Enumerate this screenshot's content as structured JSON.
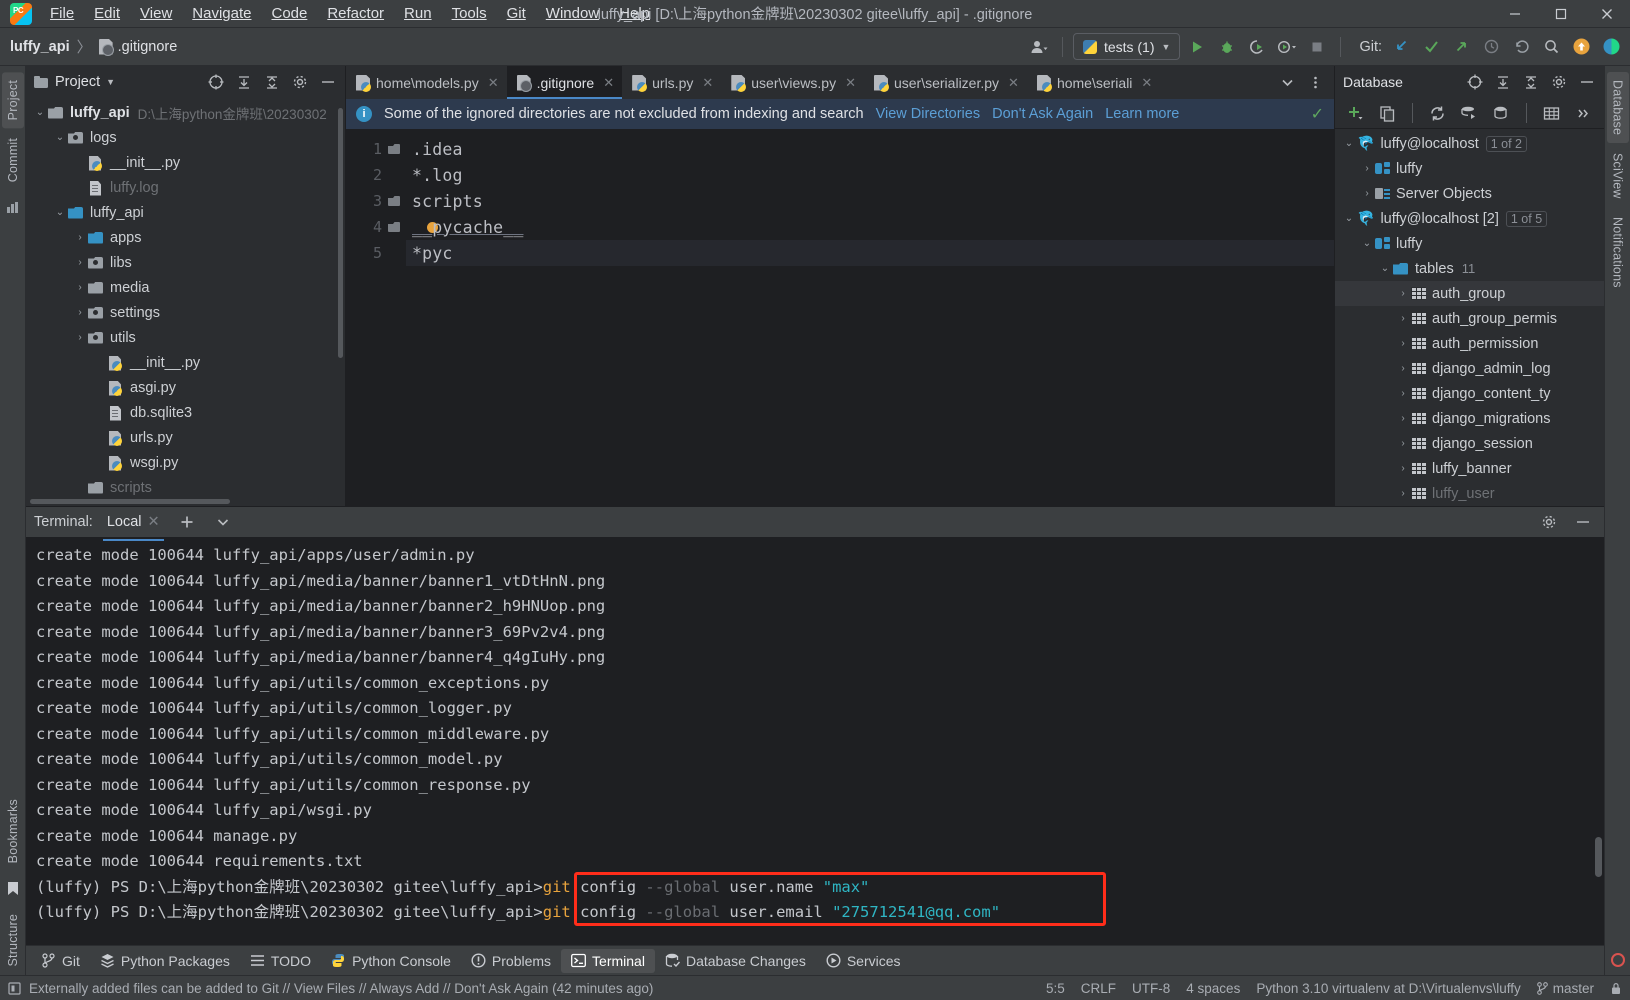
{
  "window": {
    "title": "luffy_api [D:\\上海python金牌班\\20230302 gitee\\luffy_api] - .gitignore",
    "minimize": "—",
    "maximize": "▢",
    "close": "✕"
  },
  "menu": {
    "items": [
      "File",
      "Edit",
      "View",
      "Navigate",
      "Code",
      "Refactor",
      "Run",
      "Tools",
      "Git",
      "Window",
      "Help"
    ]
  },
  "navbar": {
    "breadcrumb_project": "luffy_api",
    "breadcrumb_sep": "〉",
    "breadcrumb_file": ".gitignore",
    "run_config": "tests (1)",
    "git_label": "Git:"
  },
  "project_panel": {
    "title": "Project",
    "tree": [
      {
        "indent": 0,
        "arrow": "⌄",
        "icon": "folder",
        "label": "luffy_api",
        "bold": true,
        "note": "D:\\上海python金牌班\\20230302"
      },
      {
        "indent": 1,
        "arrow": "⌄",
        "icon": "folder-module",
        "label": "logs",
        "bold": false,
        "note": ""
      },
      {
        "indent": 2,
        "arrow": "",
        "icon": "python-file",
        "label": "__init__.py",
        "bold": false,
        "note": ""
      },
      {
        "indent": 2,
        "arrow": "",
        "icon": "text-file",
        "label": "luffy.log",
        "bold": false,
        "note": "",
        "dim": true
      },
      {
        "indent": 1,
        "arrow": "⌄",
        "icon": "folder-blue",
        "label": "luffy_api",
        "bold": false,
        "note": ""
      },
      {
        "indent": 2,
        "arrow": "›",
        "icon": "folder-blue",
        "label": "apps",
        "bold": false,
        "note": ""
      },
      {
        "indent": 2,
        "arrow": "›",
        "icon": "folder-module",
        "label": "libs",
        "bold": false,
        "note": ""
      },
      {
        "indent": 2,
        "arrow": "›",
        "icon": "folder",
        "label": "media",
        "bold": false,
        "note": ""
      },
      {
        "indent": 2,
        "arrow": "›",
        "icon": "folder-module",
        "label": "settings",
        "bold": false,
        "note": ""
      },
      {
        "indent": 2,
        "arrow": "›",
        "icon": "folder-module",
        "label": "utils",
        "bold": false,
        "note": ""
      },
      {
        "indent": 3,
        "arrow": "",
        "icon": "python-file",
        "label": "__init__.py",
        "bold": false,
        "note": ""
      },
      {
        "indent": 3,
        "arrow": "",
        "icon": "python-file",
        "label": "asgi.py",
        "bold": false,
        "note": ""
      },
      {
        "indent": 3,
        "arrow": "",
        "icon": "text-file",
        "label": "db.sqlite3",
        "bold": false,
        "note": ""
      },
      {
        "indent": 3,
        "arrow": "",
        "icon": "python-file",
        "label": "urls.py",
        "bold": false,
        "note": ""
      },
      {
        "indent": 3,
        "arrow": "",
        "icon": "python-file",
        "label": "wsgi.py",
        "bold": false,
        "note": ""
      },
      {
        "indent": 2,
        "arrow": "",
        "icon": "folder",
        "label": "scripts",
        "bold": false,
        "note": "",
        "dim": true
      }
    ]
  },
  "editor": {
    "tabs": [
      {
        "label": "home\\models.py",
        "active": false,
        "icon": "python-file"
      },
      {
        "label": ".gitignore",
        "active": true,
        "icon": "gitignore-file"
      },
      {
        "label": "urls.py",
        "active": false,
        "icon": "python-file"
      },
      {
        "label": "user\\views.py",
        "active": false,
        "icon": "python-file"
      },
      {
        "label": "user\\serializer.py",
        "active": false,
        "icon": "python-file"
      },
      {
        "label": "home\\seriali",
        "active": false,
        "icon": "python-file"
      }
    ],
    "notification": {
      "message": "Some of the ignored directories are not excluded from indexing and search",
      "action_view": "View Directories",
      "action_dismiss": "Don't Ask Again",
      "action_learn": "Learn more"
    },
    "lines": [
      {
        "n": "1",
        "fold": true,
        "text": ".idea"
      },
      {
        "n": "2",
        "fold": false,
        "text": "*.log"
      },
      {
        "n": "3",
        "fold": true,
        "text": "scripts"
      },
      {
        "n": "4",
        "fold": true,
        "text": "__pycache__",
        "caret": true
      },
      {
        "n": "5",
        "fold": false,
        "text": "*pyc",
        "current": true
      }
    ]
  },
  "database_panel": {
    "title": "Database",
    "tree": [
      {
        "indent": 0,
        "arrow": "⌄",
        "icon": "mysql",
        "label": "luffy@localhost",
        "badge": "1 of 2"
      },
      {
        "indent": 1,
        "arrow": "›",
        "icon": "schema",
        "label": "luffy",
        "badge": ""
      },
      {
        "indent": 1,
        "arrow": "›",
        "icon": "server-objects",
        "label": "Server Objects",
        "badge": ""
      },
      {
        "indent": 0,
        "arrow": "⌄",
        "icon": "mysql",
        "label": "luffy@localhost [2]",
        "badge": "1 of 5"
      },
      {
        "indent": 1,
        "arrow": "⌄",
        "icon": "schema",
        "label": "luffy",
        "badge": ""
      },
      {
        "indent": 2,
        "arrow": "⌄",
        "icon": "folder-blue",
        "label": "tables",
        "badge": "",
        "count": "11"
      },
      {
        "indent": 3,
        "arrow": "›",
        "icon": "table",
        "label": "auth_group",
        "badge": "",
        "selected": true
      },
      {
        "indent": 3,
        "arrow": "›",
        "icon": "table",
        "label": "auth_group_permis",
        "badge": ""
      },
      {
        "indent": 3,
        "arrow": "›",
        "icon": "table",
        "label": "auth_permission",
        "badge": ""
      },
      {
        "indent": 3,
        "arrow": "›",
        "icon": "table",
        "label": "django_admin_log",
        "badge": ""
      },
      {
        "indent": 3,
        "arrow": "›",
        "icon": "table",
        "label": "django_content_ty",
        "badge": ""
      },
      {
        "indent": 3,
        "arrow": "›",
        "icon": "table",
        "label": "django_migrations",
        "badge": ""
      },
      {
        "indent": 3,
        "arrow": "›",
        "icon": "table",
        "label": "django_session",
        "badge": ""
      },
      {
        "indent": 3,
        "arrow": "›",
        "icon": "table",
        "label": "luffy_banner",
        "badge": ""
      },
      {
        "indent": 3,
        "arrow": "›",
        "icon": "table",
        "label": "luffy_user",
        "badge": "",
        "dim": true
      }
    ]
  },
  "terminal": {
    "label": "Terminal:",
    "tab": "Local",
    "add": "+",
    "lines": [
      "create mode 100644 luffy_api/apps/user/admin.py",
      "create mode 100644 luffy_api/media/banner/banner1_vtDtHnN.png",
      "create mode 100644 luffy_api/media/banner/banner2_h9HNUop.png",
      "create mode 100644 luffy_api/media/banner/banner3_69Pv2v4.png",
      "create mode 100644 luffy_api/media/banner/banner4_q4gIuHy.png",
      "create mode 100644 luffy_api/utils/common_exceptions.py",
      "create mode 100644 luffy_api/utils/common_logger.py",
      "create mode 100644 luffy_api/utils/common_middleware.py",
      "create mode 100644 luffy_api/utils/common_model.py",
      "create mode 100644 luffy_api/utils/common_response.py",
      "create mode 100644 luffy_api/wsgi.py",
      "create mode 100644 manage.py",
      "create mode 100644 requirements.txt"
    ],
    "prompt": "(luffy) PS D:\\上海python金牌班\\20230302 gitee\\luffy_api>",
    "commands": [
      {
        "cmd": "git",
        "sub": " config ",
        "flag": "--global",
        "arg": " user.name ",
        "value": "\"max\""
      },
      {
        "cmd": "git",
        "sub": " config ",
        "flag": "--global",
        "arg": " user.email ",
        "value": "\"275712541@qq.com\""
      }
    ],
    "highlight_color": "#ff2d1a"
  },
  "bottom_tools": [
    {
      "label": "Git",
      "icon": "git-branch-icon",
      "selected": false
    },
    {
      "label": "Python Packages",
      "icon": "packages-icon",
      "selected": false
    },
    {
      "label": "TODO",
      "icon": "todo-icon",
      "selected": false
    },
    {
      "label": "Python Console",
      "icon": "python-icon",
      "selected": false
    },
    {
      "label": "Problems",
      "icon": "problems-icon",
      "selected": false
    },
    {
      "label": "Terminal",
      "icon": "terminal-icon",
      "selected": true
    },
    {
      "label": "Database Changes",
      "icon": "database-icon",
      "selected": false
    },
    {
      "label": "Services",
      "icon": "services-icon",
      "selected": false
    }
  ],
  "left_rail": [
    "Project",
    "Commit",
    "SciView"
  ],
  "right_rail": [
    "Database",
    "SciView",
    "Notifications"
  ],
  "far_left_rail": [
    "Bookmarks",
    "Structure"
  ],
  "statusbar": {
    "message": "Externally added files can be added to Git // View Files // Always Add // Don't Ask Again (42 minutes ago)",
    "position": "5:5",
    "line_sep": "CRLF",
    "encoding": "UTF-8",
    "indent": "4 spaces",
    "interpreter": "Python 3.10 virtualenv at D:\\Virtualenvs\\luffy",
    "branch": "master"
  }
}
